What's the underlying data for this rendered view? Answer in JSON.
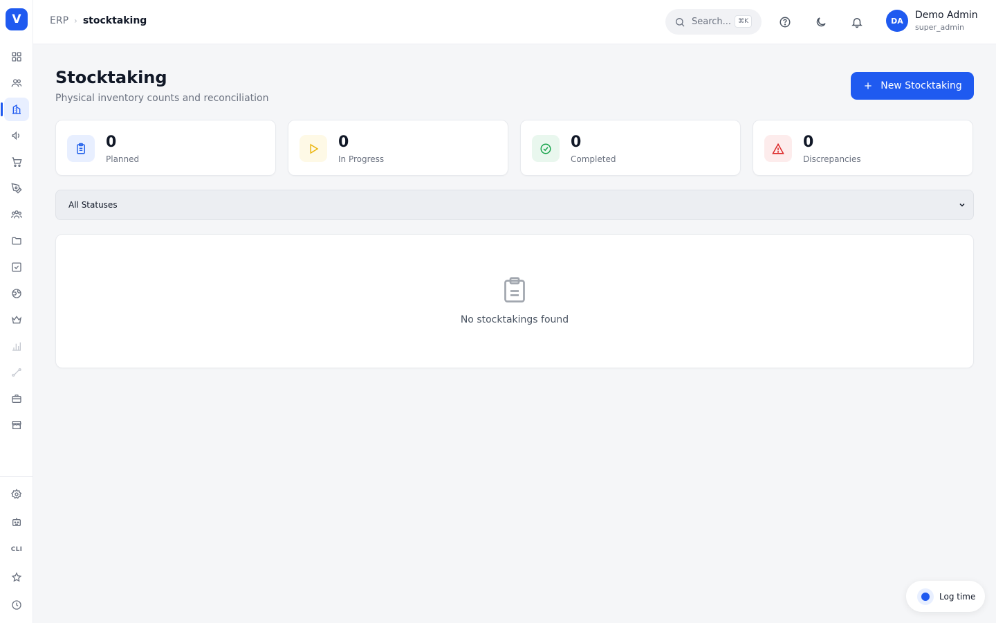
{
  "app": {
    "logo_letter": "V"
  },
  "breadcrumb": {
    "root": "ERP",
    "separator": "›",
    "current": "stocktaking"
  },
  "search": {
    "placeholder": "Search...",
    "shortcut": "⌘K"
  },
  "user": {
    "initials": "DA",
    "name": "Demo Admin",
    "role": "super_admin"
  },
  "page": {
    "title": "Stocktaking",
    "subtitle": "Physical inventory counts and reconciliation",
    "new_button": "New Stocktaking"
  },
  "stats": [
    {
      "value": "0",
      "label": "Planned",
      "icon": "clipboard-list-icon",
      "color": "#2563eb",
      "bg": "#e8efff"
    },
    {
      "value": "0",
      "label": "In Progress",
      "icon": "play-icon",
      "color": "#eab308",
      "bg": "#fef9e6"
    },
    {
      "value": "0",
      "label": "Completed",
      "icon": "check-circle-icon",
      "color": "#16a34a",
      "bg": "#e9f7ee"
    },
    {
      "value": "0",
      "label": "Discrepancies",
      "icon": "alert-triangle-icon",
      "color": "#dc2626",
      "bg": "#fdecec"
    }
  ],
  "filter": {
    "selected": "All Statuses"
  },
  "empty_state": {
    "message": "No stocktakings found",
    "icon": "clipboard-icon"
  },
  "log_time": {
    "label": "Log time"
  },
  "sidebar": {
    "cli_label": "CLI",
    "items": [
      "dashboard-grid-icon",
      "users-icon",
      "building-icon",
      "megaphone-icon",
      "cart-icon",
      "pen-tool-icon",
      "team-icon",
      "folder-icon",
      "checkbox-icon",
      "globe-icon",
      "crown-icon",
      "bar-chart-icon",
      "route-icon",
      "briefcase-icon",
      "store-icon",
      "settings-icon",
      "bot-icon",
      "terminal-cli",
      "star-icon",
      "clock-icon"
    ]
  },
  "colors": {
    "accent": "#1f5af0",
    "background": "#f5f6f8"
  }
}
